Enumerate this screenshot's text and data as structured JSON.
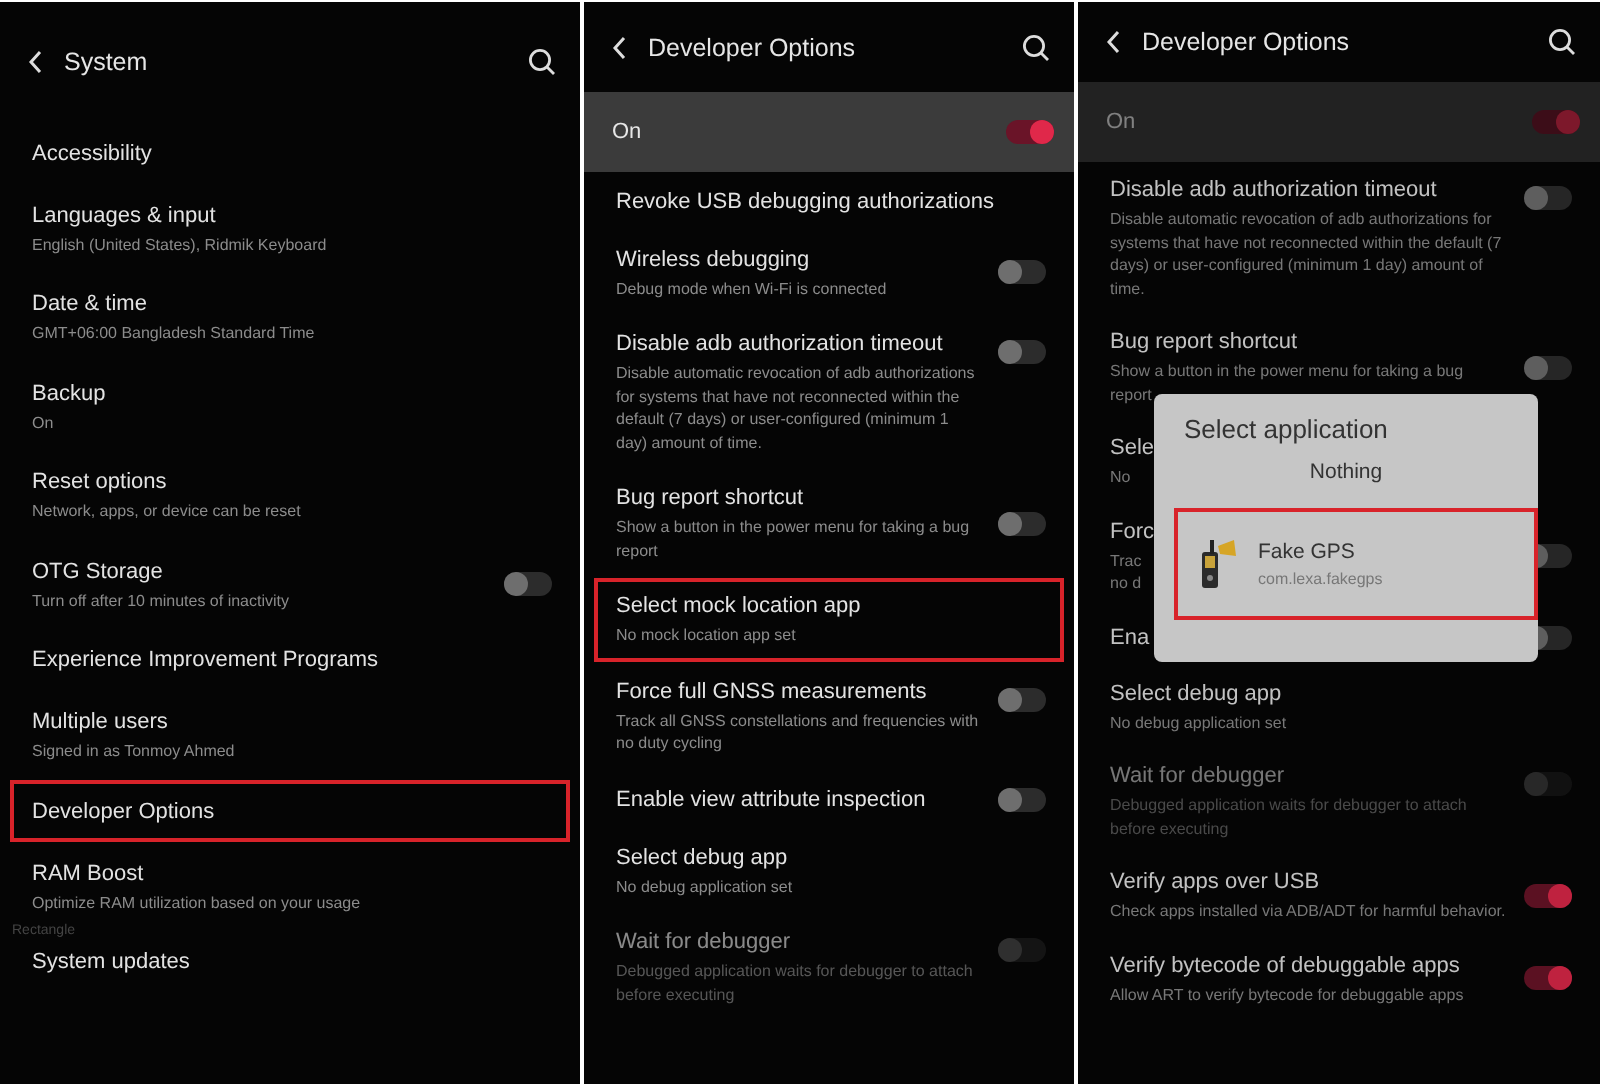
{
  "panels": [
    {
      "title": "System",
      "items": [
        {
          "kind": "row",
          "title": "Accessibility",
          "highlighted": false
        },
        {
          "kind": "row",
          "title": "Languages & input",
          "subtitle": "English (United States), Ridmik Keyboard",
          "highlighted": false
        },
        {
          "kind": "row",
          "title": "Date & time",
          "subtitle": "GMT+06:00 Bangladesh Standard Time",
          "highlighted": false
        },
        {
          "kind": "row",
          "title": "Backup",
          "subtitle": "On",
          "highlighted": false
        },
        {
          "kind": "row",
          "title": "Reset options",
          "subtitle": "Network, apps, or device can be reset",
          "highlighted": false
        },
        {
          "kind": "toggle",
          "title": "OTG Storage",
          "subtitle": "Turn off after 10 minutes of inactivity",
          "on": false,
          "disabled": false,
          "highlighted": false
        },
        {
          "kind": "row",
          "title": "Experience Improvement Programs",
          "highlighted": false
        },
        {
          "kind": "row",
          "title": "Multiple users",
          "subtitle": "Signed in as Tonmoy Ahmed",
          "highlighted": false
        },
        {
          "kind": "row",
          "title": "Developer Options",
          "highlighted": true
        },
        {
          "kind": "row",
          "title": "RAM Boost",
          "subtitle": "Optimize RAM utilization based on your usage",
          "highlighted": false
        },
        {
          "kind": "row",
          "title": "System updates",
          "highlighted": false,
          "overlay_label": "Rectangle"
        }
      ]
    },
    {
      "title": "Developer Options",
      "master_switch": {
        "label": "On",
        "on": true
      },
      "items": [
        {
          "kind": "row",
          "title": "Revoke USB debugging authorizations",
          "highlighted": false
        },
        {
          "kind": "toggle",
          "title": "Wireless debugging",
          "subtitle": "Debug mode when Wi-Fi is connected",
          "on": false,
          "disabled": false,
          "highlighted": false
        },
        {
          "kind": "toggle",
          "title": "Disable adb authorization timeout",
          "subtitle": "Disable automatic revocation of adb authorizations for systems that have not reconnected within the default (7 days) or user-configured (minimum 1 day) amount of time.",
          "on": false,
          "disabled": false,
          "highlighted": false
        },
        {
          "kind": "toggle",
          "title": "Bug report shortcut",
          "subtitle": "Show a button in the power menu for taking a bug report",
          "on": false,
          "disabled": false,
          "highlighted": false
        },
        {
          "kind": "row",
          "title": "Select mock location app",
          "subtitle": "No mock location app set",
          "highlighted": true
        },
        {
          "kind": "toggle",
          "title": "Force full GNSS measurements",
          "subtitle": "Track all GNSS constellations and frequencies with no duty cycling",
          "on": false,
          "disabled": false,
          "highlighted": false
        },
        {
          "kind": "toggle",
          "title": "Enable view attribute inspection",
          "on": false,
          "disabled": false,
          "highlighted": false
        },
        {
          "kind": "row",
          "title": "Select debug app",
          "subtitle": "No debug application set",
          "highlighted": false
        },
        {
          "kind": "toggle",
          "title": "Wait for debugger",
          "subtitle": "Debugged application waits for debugger to attach before executing",
          "on": false,
          "disabled": true,
          "highlighted": false
        }
      ]
    },
    {
      "title": "Developer Options",
      "master_switch": {
        "label": "On",
        "on": true
      },
      "items": [
        {
          "kind": "toggle",
          "title": "Disable adb authorization timeout",
          "subtitle": "Disable automatic revocation of adb authorizations for systems that have not reconnected within the default (7 days) or user-configured (minimum 1 day) amount of time.",
          "on": false,
          "disabled": false,
          "highlighted": false
        },
        {
          "kind": "toggle",
          "title": "Bug report shortcut",
          "subtitle": "Show a button in the power menu for taking a bug report",
          "on": false,
          "disabled": false,
          "highlighted": false
        },
        {
          "kind": "row",
          "title": "Sele",
          "subtitle": "No",
          "highlighted": false
        },
        {
          "kind": "toggle",
          "title": "Forc",
          "subtitle": "Trac\nno d",
          "on": false,
          "disabled": false,
          "highlighted": false
        },
        {
          "kind": "toggle",
          "title": "Ena",
          "on": false,
          "disabled": false,
          "highlighted": false
        },
        {
          "kind": "row",
          "title": "Select debug app",
          "subtitle": "No debug application set",
          "highlighted": false
        },
        {
          "kind": "toggle",
          "title": "Wait for debugger",
          "subtitle": "Debugged application waits for debugger to attach before executing",
          "on": false,
          "disabled": true,
          "highlighted": false
        },
        {
          "kind": "toggle",
          "title": "Verify apps over USB",
          "subtitle": "Check apps installed via ADB/ADT for harmful behavior.",
          "on": true,
          "disabled": false,
          "highlighted": false
        },
        {
          "kind": "toggle",
          "title": "Verify bytecode of debuggable apps",
          "subtitle": "Allow ART to verify bytecode for debuggable apps",
          "on": true,
          "disabled": false,
          "highlighted": false
        }
      ],
      "dialog": {
        "title": "Select application",
        "options": [
          {
            "kind": "none",
            "label": "Nothing",
            "highlighted": false
          },
          {
            "kind": "app",
            "label": "Fake GPS",
            "package": "com.lexa.fakegps",
            "highlighted": true
          }
        ]
      }
    }
  ]
}
